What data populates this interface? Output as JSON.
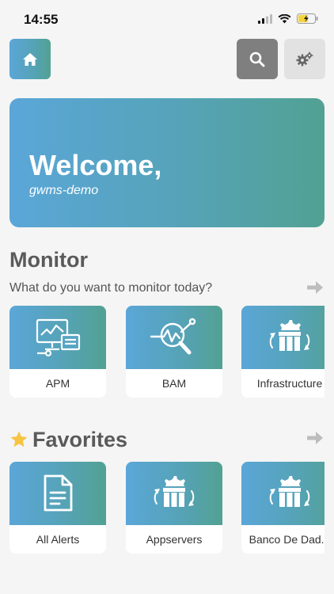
{
  "status_bar": {
    "time": "14:55"
  },
  "welcome": {
    "title": "Welcome,",
    "user": "gwms-demo"
  },
  "monitor": {
    "title": "Monitor",
    "subtitle": "What do you want to monitor today?",
    "items": [
      {
        "label": "APM",
        "icon": "monitor-icon"
      },
      {
        "label": "BAM",
        "icon": "analytics-icon"
      },
      {
        "label": "Infrastructure",
        "icon": "infrastructure-icon"
      }
    ]
  },
  "favorites": {
    "title": "Favorites",
    "items": [
      {
        "label": "All Alerts",
        "icon": "document-icon"
      },
      {
        "label": "Appservers",
        "icon": "infrastructure-icon"
      },
      {
        "label": "Banco De Dad...",
        "icon": "infrastructure-icon"
      }
    ]
  },
  "colors": {
    "gradient_start": "#5aa6d8",
    "gradient_end": "#52a193",
    "search_bg": "#7f7f7f",
    "settings_bg": "#e2e2e2",
    "star": "#f6c343"
  }
}
